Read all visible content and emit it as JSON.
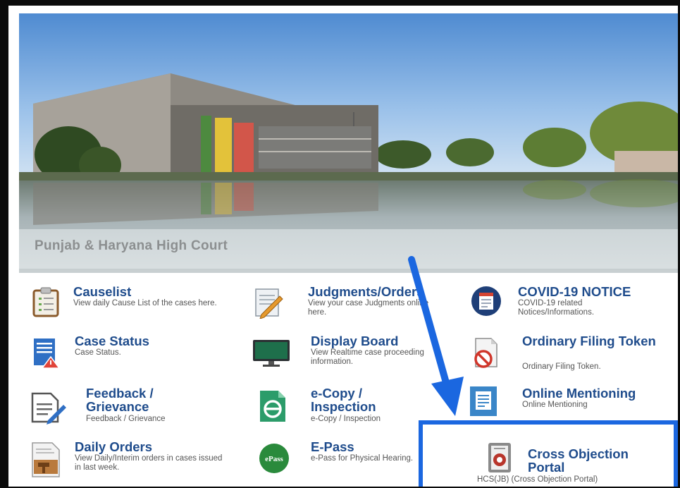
{
  "hero": {
    "caption": "Punjab & Haryana High Court"
  },
  "tiles": [
    {
      "title": "Causelist",
      "desc": "View daily Cause List of the cases here.",
      "icon": "clipboard-icon"
    },
    {
      "title": "Judgments/Orders",
      "desc": "View your case Judgments online here.",
      "icon": "notepad-pencil-icon"
    },
    {
      "title": "COVID-19 NOTICE",
      "desc": "COVID-19 related Notices/Informations.",
      "icon": "covid-notice-icon"
    },
    {
      "title": "Case Status",
      "desc": "Case Status.",
      "icon": "case-status-document-icon"
    },
    {
      "title": "Display Board",
      "desc": "View Realtime case proceeding information.",
      "icon": "monitor-icon"
    },
    {
      "title": "Ordinary Filing Token",
      "desc": "Ordinary Filing Token.",
      "icon": "no-entry-document-icon"
    },
    {
      "title": "Feedback / Grievance",
      "desc": "Feedback / Grievance",
      "icon": "feedback-form-icon"
    },
    {
      "title": "e-Copy / Inspection",
      "desc": "e-Copy / Inspection",
      "icon": "ecopy-icon"
    },
    {
      "title": "Online Mentioning",
      "desc": "Online Mentioning",
      "icon": "online-mentioning-icon"
    },
    {
      "title": "Daily Orders",
      "desc": "View Daily/Interim orders in cases issued in last week.",
      "icon": "gavel-document-icon"
    },
    {
      "title": "E-Pass",
      "desc": "e-Pass for Physical Hearing.",
      "icon": "epass-icon",
      "icon_label": "ePass"
    },
    {
      "title": "Cross Objection Portal",
      "desc": "HCS(JB) (Cross Objection Portal)",
      "icon": "cross-objection-icon"
    }
  ],
  "colors": {
    "title": "#1f4c8c",
    "highlight": "#1b67e0",
    "arrow": "#1b67e0"
  }
}
